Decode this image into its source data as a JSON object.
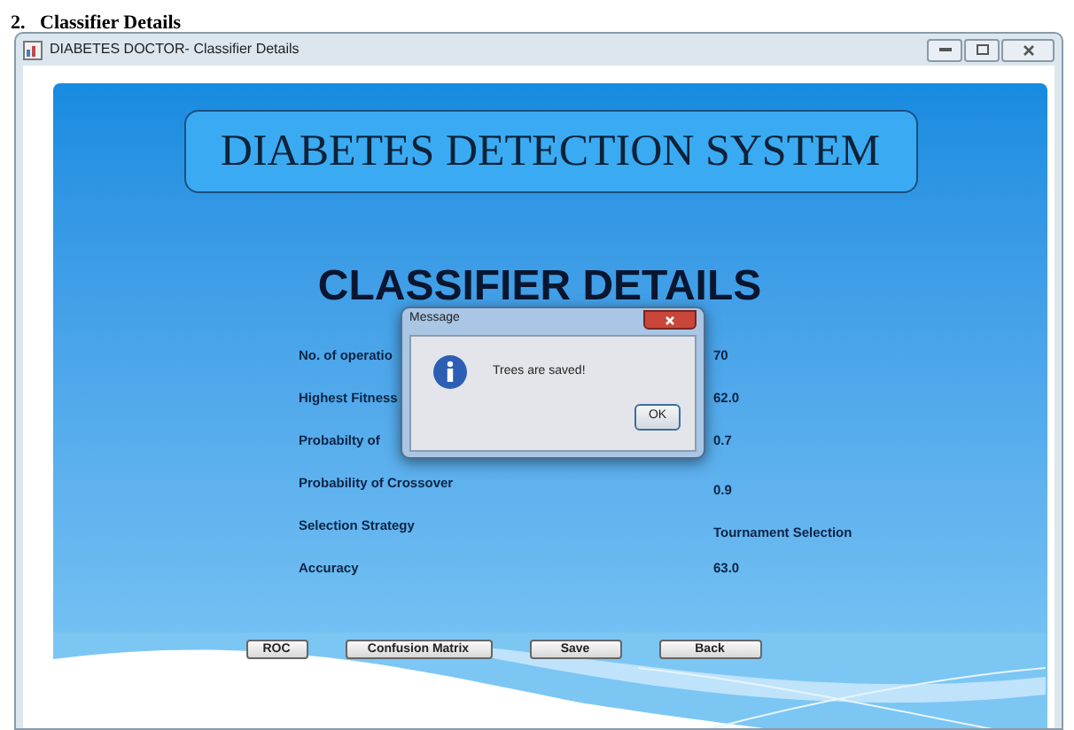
{
  "page_heading": "2.   Classifier Details",
  "window": {
    "title": "DIABETES DOCTOR- Classifier Details"
  },
  "banner": "DIABETES DETECTION SYSTEM",
  "heading": "CLASSIFIER DETAILS",
  "details": [
    {
      "label": "No. of operatio",
      "value": "70"
    },
    {
      "label": "Highest Fitness",
      "value": "62.0"
    },
    {
      "label": "Probabilty of",
      "value": "0.7"
    },
    {
      "label": "Probability of Crossover",
      "value": "0.9"
    },
    {
      "label": "Selection Strategy",
      "value": "Tournament Selection"
    },
    {
      "label": "Accuracy",
      "value": "63.0"
    }
  ],
  "buttons": [
    "ROC",
    "Confusion Matrix",
    "Save",
    "Back"
  ],
  "dialog": {
    "title": "Message",
    "message": "Trees are saved!",
    "button": "OK"
  }
}
